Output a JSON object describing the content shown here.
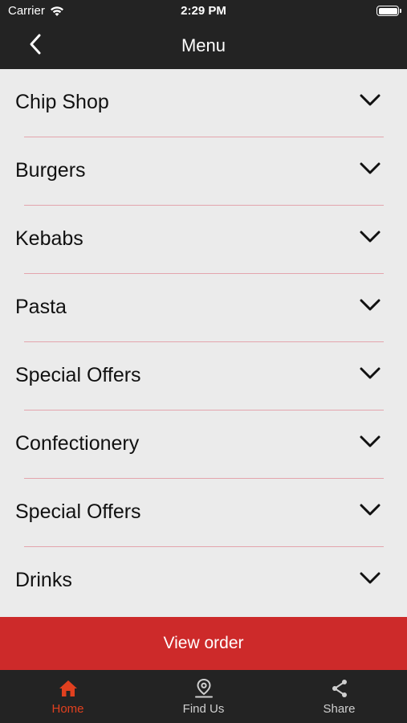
{
  "status_bar": {
    "carrier": "Carrier",
    "time": "2:29 PM"
  },
  "nav": {
    "title": "Menu",
    "back_icon": "chevron-left-icon"
  },
  "menu": {
    "divider_color": "#e3a5ad",
    "items": [
      {
        "label": "Chip Shop"
      },
      {
        "label": "Burgers"
      },
      {
        "label": "Kebabs"
      },
      {
        "label": "Pasta"
      },
      {
        "label": "Special Offers"
      },
      {
        "label": "Confectionery"
      },
      {
        "label": "Special Offers"
      },
      {
        "label": "Drinks"
      }
    ]
  },
  "view_order": {
    "label": "View order",
    "color": "#cd2a2a"
  },
  "tabs": [
    {
      "label": "Home",
      "icon": "home-icon",
      "active": true
    },
    {
      "label": "Find Us",
      "icon": "map-pin-icon",
      "active": false
    },
    {
      "label": "Share",
      "icon": "share-icon",
      "active": false
    }
  ],
  "colors": {
    "bar_bg": "#232323",
    "list_bg": "#ebebeb",
    "accent": "#e0401f"
  }
}
